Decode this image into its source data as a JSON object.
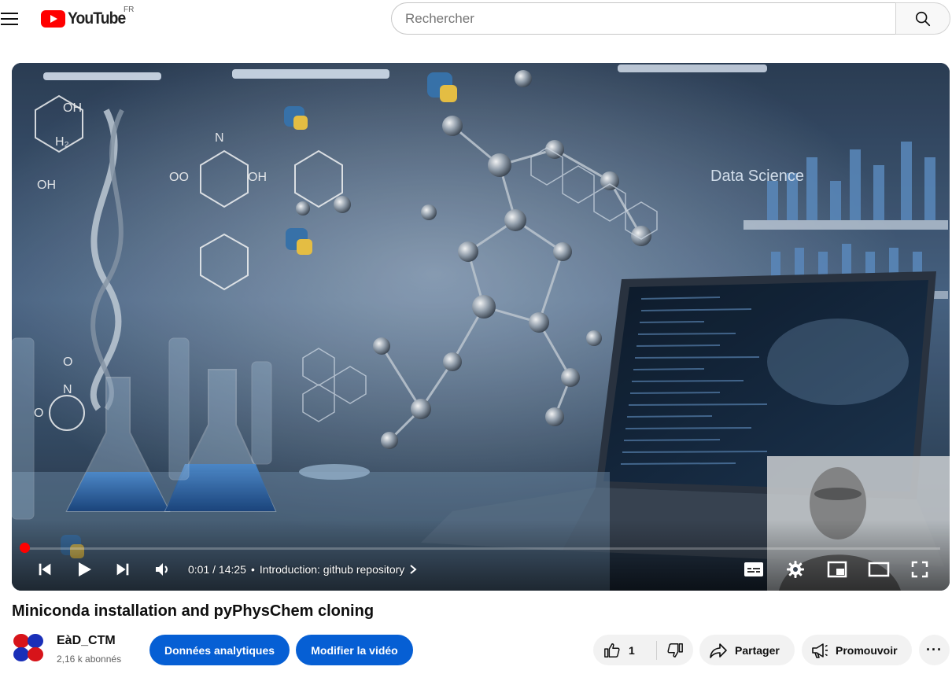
{
  "masthead": {
    "logo_text": "YouTube",
    "country_code": "FR",
    "search_placeholder": "Rechercher",
    "icons": [
      "menu-icon",
      "search-icon"
    ]
  },
  "player": {
    "thumbnail_label": "Data Science",
    "progress_fraction": 0.001,
    "time_current": "0:01",
    "time_total": "14:25",
    "time_display": "0:01 / 14:25",
    "separator": "•",
    "chapter_title": "Introduction: github repository",
    "controls": [
      "previous-icon",
      "play-icon",
      "next-icon",
      "volume-icon",
      "subtitles-icon",
      "settings-icon",
      "miniplayer-icon",
      "theater-icon",
      "fullscreen-icon"
    ],
    "accent_color": "#ff0000"
  },
  "video": {
    "title": "Miniconda installation and pyPhysChem cloning"
  },
  "channel": {
    "name": "EàD_CTM",
    "subscribers": "2,16 k abonnés"
  },
  "actions": {
    "analytics_label": "Données analytiques",
    "edit_label": "Modifier la vidéo",
    "like_count": "1",
    "share_label": "Partager",
    "promote_label": "Promouvoir",
    "more_label": "···",
    "brand_blue": "#065fd4"
  }
}
